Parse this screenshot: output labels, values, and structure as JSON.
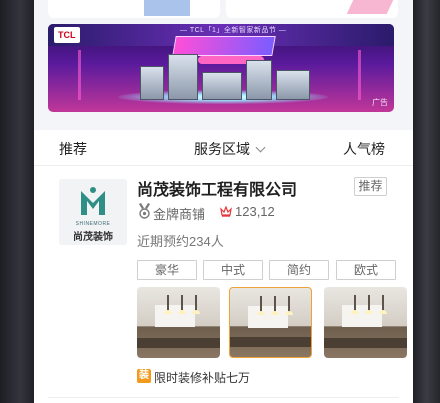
{
  "banner": {
    "brand": "TCL",
    "slogan": "— TCL「1」全新智家新品节 —",
    "ad_label": "广告"
  },
  "tabs": {
    "recommend": "推荐",
    "service_area": "服务区域",
    "popularity": "人气榜"
  },
  "company": {
    "name": "尚茂装饰工程有限公司",
    "badge": "推荐",
    "level": "金牌商铺",
    "stat": "123,12",
    "recent": "近期预约234人",
    "logo_en": "SHINEMORE",
    "logo_cn": "尚茂装饰",
    "tags": [
      "豪华",
      "中式",
      "简约",
      "欧式"
    ],
    "subsidy_icon": "装",
    "subsidy": "限时装修补贴七万"
  },
  "colors": {
    "accent": "#f29a1b",
    "logo_teal": "#2f8f86"
  },
  "icons": {
    "medal": "medal-icon",
    "stat": "crown-icon",
    "chevron": "chevron-down-icon"
  }
}
